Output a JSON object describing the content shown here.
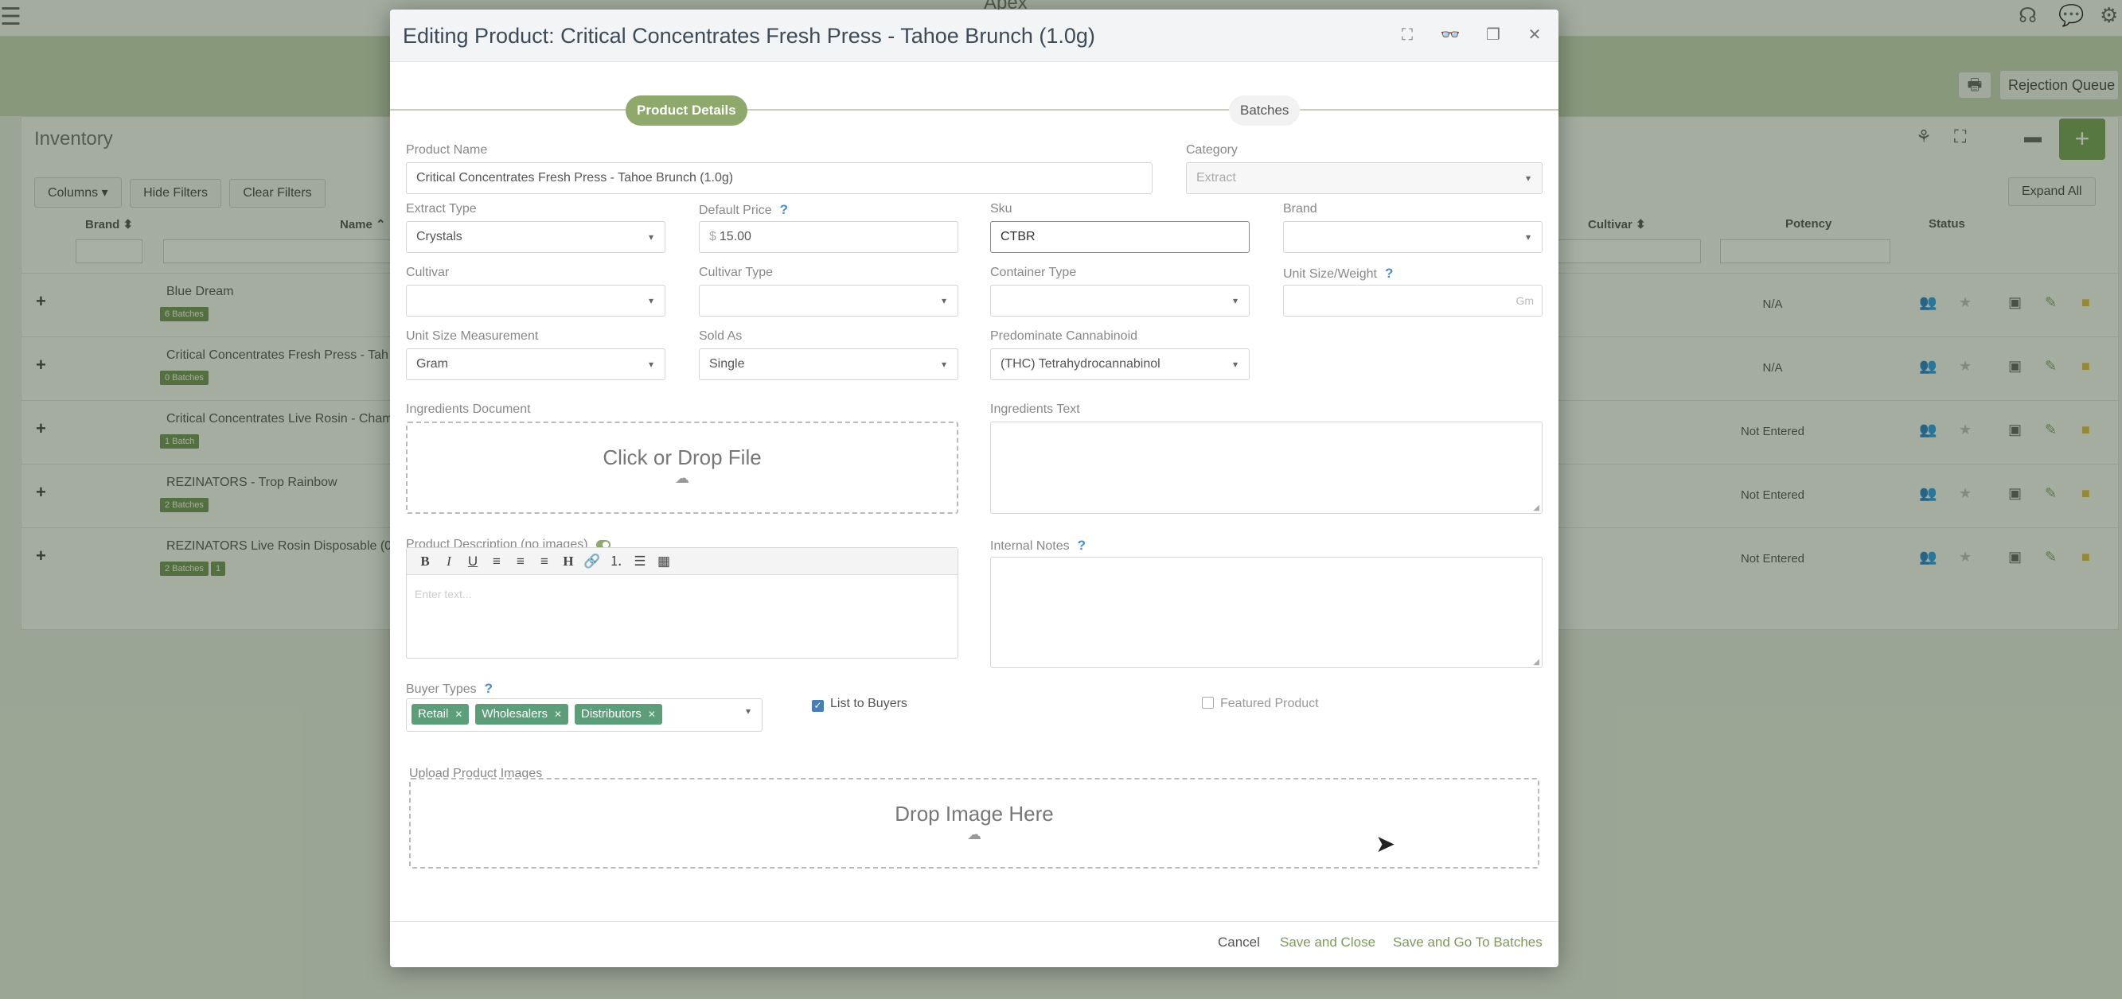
{
  "app": {
    "title": "Apex"
  },
  "header_icons": [
    "headset-icon",
    "chat-icon",
    "gear-icon"
  ],
  "toolbar_buttons": {
    "print": "print-icon",
    "rejection_queue": "Rejection Queue"
  },
  "inventory": {
    "title": "Inventory",
    "toolbar": {
      "columns": "Columns ▾",
      "hide_filters": "Hide Filters",
      "clear_filters": "Clear Filters",
      "expand_all": "Expand All"
    },
    "columns": [
      "Brand ⬍",
      "Name ⌃",
      "Cultivar ⬍",
      "Potency",
      "Status"
    ],
    "rows": [
      {
        "name": "Blue Dream",
        "badges": [
          "6 Batches"
        ],
        "potency": "N/A"
      },
      {
        "name": "Critical Concentrates Fresh Press - Tah",
        "badges": [
          "0 Batches"
        ],
        "potency": "N/A"
      },
      {
        "name": "Critical Concentrates Live Rosin - Cham",
        "badges": [
          "1 Batch"
        ],
        "potency": "Not Entered"
      },
      {
        "name": "REZINATORS - Trop Rainbow",
        "badges": [
          "2 Batches"
        ],
        "potency": "Not Entered"
      },
      {
        "name": "REZINATORS Live Rosin Disposable (0.",
        "badges": [
          "2 Batches",
          "1"
        ],
        "potency": "Not Entered"
      }
    ]
  },
  "modal": {
    "title": "Editing Product: Critical Concentrates Fresh Press - Tahoe Brunch (1.0g)",
    "steps": {
      "active": "Product Details",
      "next": "Batches"
    },
    "product_name": {
      "label": "Product Name",
      "value": "Critical Concentrates Fresh Press - Tahoe Brunch (1.0g)"
    },
    "category": {
      "label": "Category",
      "value": "Extract"
    },
    "extract_type": {
      "label": "Extract Type",
      "value": "Crystals"
    },
    "default_price": {
      "label": "Default Price",
      "prefix": "$",
      "value": "15.00"
    },
    "sku": {
      "label": "Sku",
      "value": "CTBR"
    },
    "brand": {
      "label": "Brand",
      "value": ""
    },
    "cultivar": {
      "label": "Cultivar",
      "value": ""
    },
    "cultivar_type": {
      "label": "Cultivar Type",
      "value": ""
    },
    "container_type": {
      "label": "Container Type",
      "value": ""
    },
    "unit_size_weight": {
      "label": "Unit Size/Weight",
      "suffix": "Gm",
      "value": ""
    },
    "unit_size_measurement": {
      "label": "Unit Size Measurement",
      "value": "Gram"
    },
    "sold_as": {
      "label": "Sold As",
      "value": "Single"
    },
    "predominate_cannabinoid": {
      "label": "Predominate Cannabinoid",
      "value": "(THC) Tetrahydrocannabinol"
    },
    "ingredients_document": {
      "label": "Ingredients Document",
      "dropzone": "Click or Drop File"
    },
    "ingredients_text": {
      "label": "Ingredients Text"
    },
    "product_description": {
      "label": "Product Description (no images)",
      "placeholder": "Enter text..."
    },
    "internal_notes": {
      "label": "Internal Notes"
    },
    "buyer_types": {
      "label": "Buyer Types",
      "tags": [
        "Retail",
        "Wholesalers",
        "Distributors"
      ]
    },
    "list_to_buyers": {
      "label": "List to Buyers",
      "checked": true
    },
    "featured_product": {
      "label": "Featured Product",
      "checked": false
    },
    "upload_images": {
      "label": "Upload Product Images",
      "dropzone": "Drop Image Here"
    },
    "footer": {
      "cancel": "Cancel",
      "save_close": "Save and Close",
      "save_batches": "Save and Go To Batches"
    },
    "help_mark": "?"
  }
}
